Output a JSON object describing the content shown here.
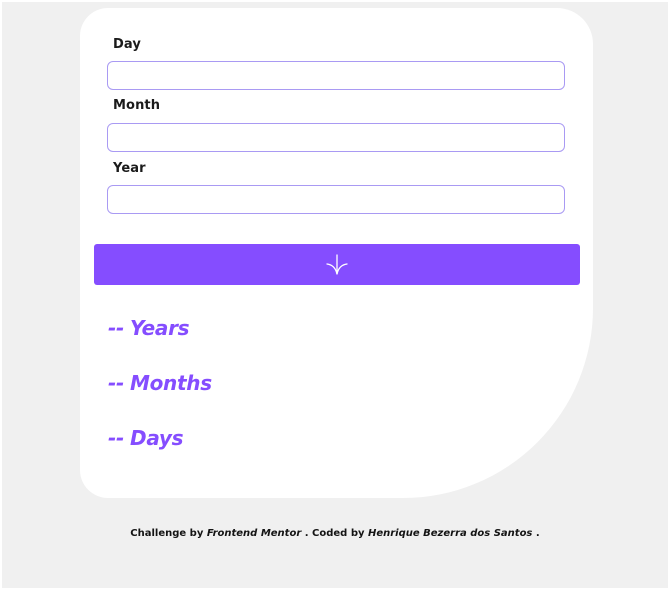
{
  "form": {
    "day": {
      "label": "Day",
      "value": ""
    },
    "month": {
      "label": "Month",
      "value": ""
    },
    "year": {
      "label": "Year",
      "value": ""
    }
  },
  "submit": {
    "icon": "arrow-down-icon"
  },
  "results": {
    "years": {
      "value": "--",
      "unit": "Years"
    },
    "months": {
      "value": "--",
      "unit": "Months"
    },
    "days": {
      "value": "--",
      "unit": "Days"
    }
  },
  "footer": {
    "challenge_by": "Challenge by",
    "frontend_mentor": "Frontend Mentor",
    "coded_by": ". Coded by",
    "author": "Henrique Bezerra dos Santos",
    "end": "."
  },
  "colors": {
    "accent": "#854dff",
    "input_border": "#a99af3",
    "page_background": "#f0f0f0",
    "card_background": "#ffffff"
  }
}
